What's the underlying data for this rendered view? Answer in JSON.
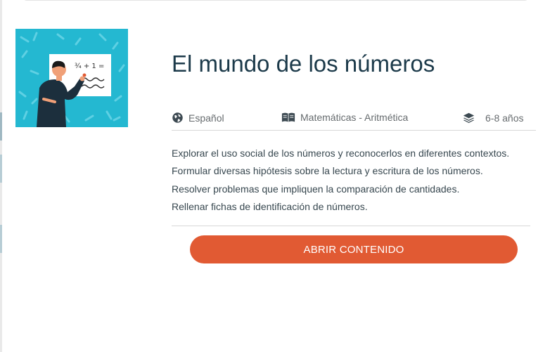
{
  "course": {
    "title": "El mundo de los números",
    "thumbnail_icon": "teacher-at-whiteboard-illustration",
    "thumbnail_board_text": "¾ + 1 =",
    "meta": {
      "language": "Español",
      "language_icon": "globe-icon",
      "subject": "Matemáticas - Aritmética",
      "subject_icon": "book-icon",
      "age": "6-8 años",
      "age_icon": "layers-icon"
    },
    "objectives": [
      "Explorar el uso social de los números y reconocerlos en diferentes contextos.",
      "Formular diversas hipótesis sobre la lectura y escritura de los números.",
      "Resolver problemas que impliquen la comparación de cantidades.",
      "Rellenar fichas de identificación de números."
    ],
    "cta_label": "ABRIR CONTENIDO"
  },
  "colors": {
    "accent": "#e15a33",
    "thumbnail_bg": "#24b8d1",
    "title": "#1c3a4a",
    "text": "#37474f"
  }
}
